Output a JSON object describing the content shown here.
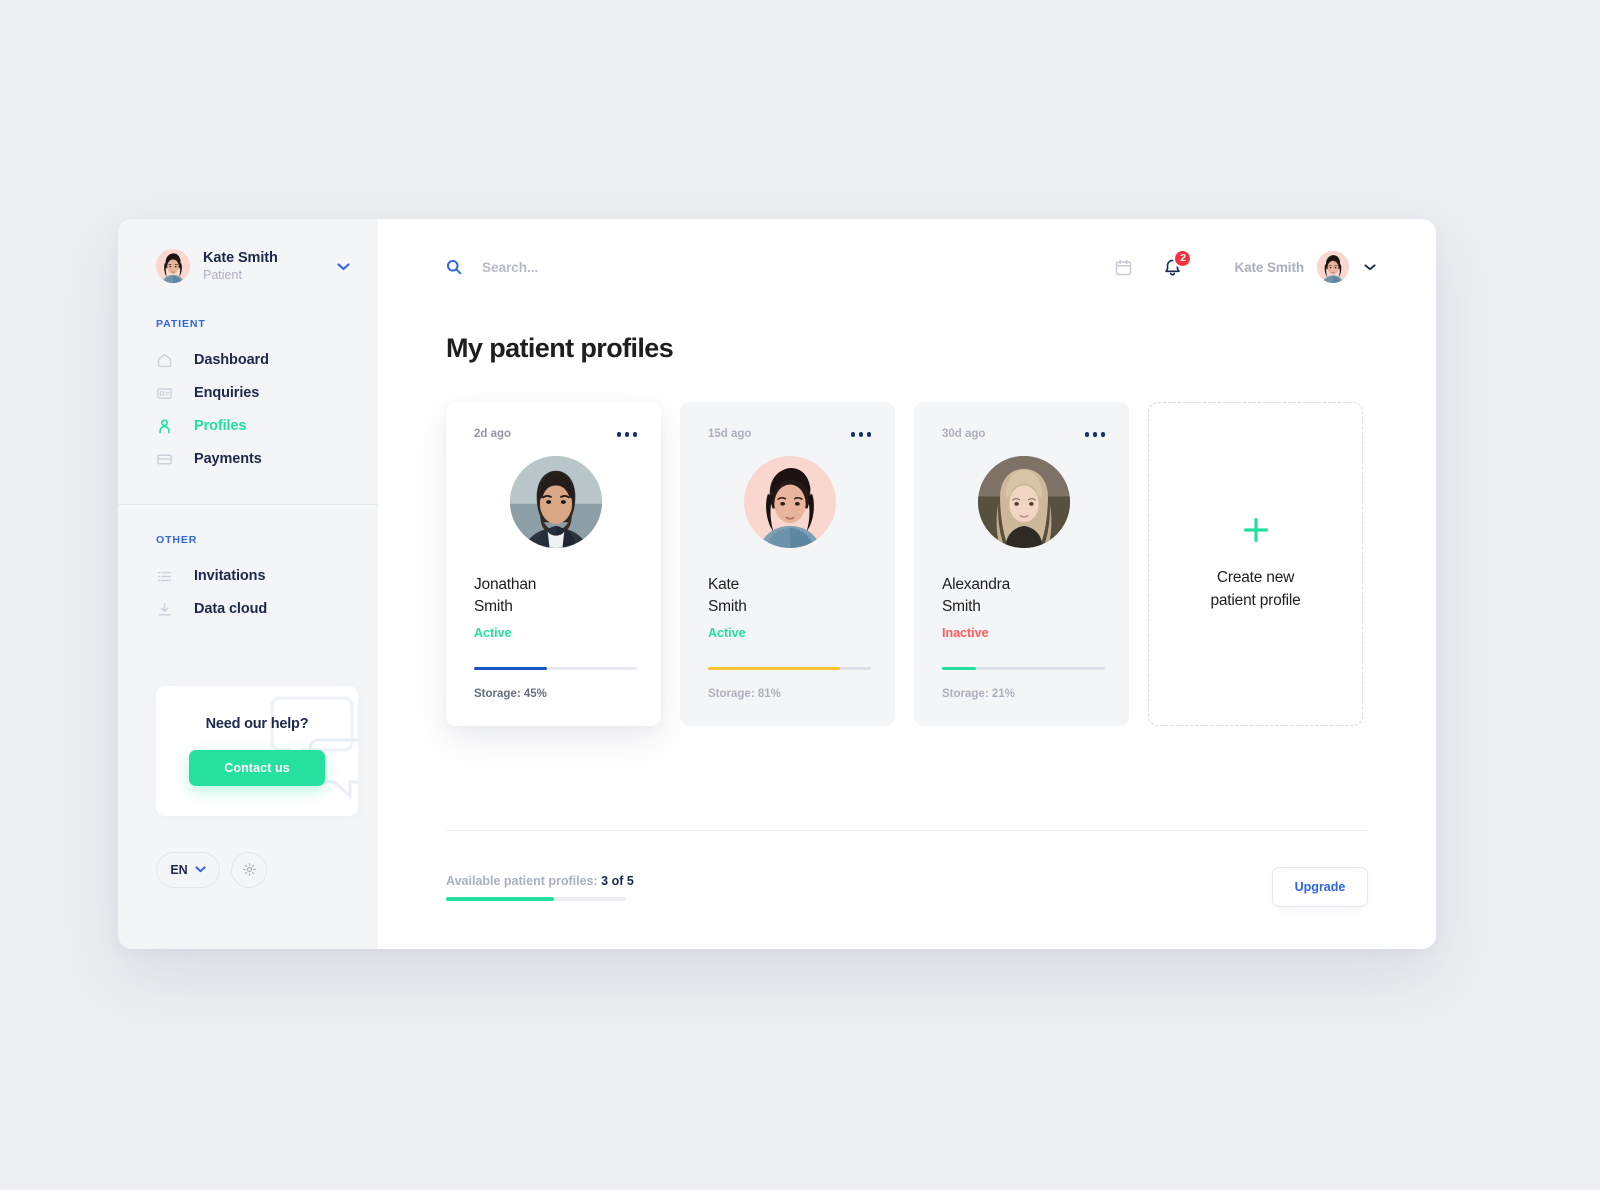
{
  "sidebar": {
    "user": {
      "name": "Kate Smith",
      "role": "Patient",
      "chevron": "chevron-down-icon"
    },
    "section_patient_label": "PATIENT",
    "patient_items": [
      {
        "label": "Dashboard",
        "icon": "home-icon",
        "active": false
      },
      {
        "label": "Enquiries",
        "icon": "id-card-icon",
        "active": false
      },
      {
        "label": "Profiles",
        "icon": "person-icon",
        "active": true
      },
      {
        "label": "Payments",
        "icon": "credit-card-icon",
        "active": false
      }
    ],
    "section_other_label": "OTHER",
    "other_items": [
      {
        "label": "Invitations",
        "icon": "list-icon",
        "active": false
      },
      {
        "label": "Data cloud",
        "icon": "download-icon",
        "active": false
      }
    ],
    "help": {
      "title": "Need our help?",
      "button_label": "Contact us"
    },
    "language": {
      "value": "EN",
      "chevron": "chevron-down-icon"
    },
    "settings_icon": "gear-icon"
  },
  "topbar": {
    "search": {
      "value": "",
      "placeholder": "Search..."
    },
    "calendar_icon": "calendar-icon",
    "bell_icon": "bell-icon",
    "notification_count": "2",
    "user_name": "Kate Smith",
    "user_chevron": "chevron-down-icon"
  },
  "main": {
    "page_title": "My patient profiles",
    "cards": [
      {
        "age": "2d ago",
        "name_line1": "Jonathan",
        "name_line2": "Smith",
        "status": "Active",
        "status_color": "#24e0a0",
        "storage_label": "Storage: 45%",
        "storage_percent": 45,
        "bar_color": "#1a56c4",
        "photo": "photo-jonathan",
        "menu_icon": "more-horizontal-icon",
        "elevated": true
      },
      {
        "age": "15d ago",
        "name_line1": "Kate",
        "name_line2": "Smith",
        "status": "Active",
        "status_color": "#24e0a0",
        "storage_label": "Storage: 81%",
        "storage_percent": 81,
        "bar_color": "#f7c12f",
        "photo": "photo-kate",
        "menu_icon": "more-horizontal-icon",
        "elevated": false
      },
      {
        "age": "30d ago",
        "name_line1": "Alexandra",
        "name_line2": "Smith",
        "status": "Inactive",
        "status_color": "#ff5c5c",
        "storage_label": "Storage: 21%",
        "storage_percent": 21,
        "bar_color": "#24e0a0",
        "photo": "photo-alexandra",
        "menu_icon": "more-horizontal-icon",
        "elevated": false
      }
    ],
    "create_card": {
      "plus_icon": "plus-icon",
      "text_line1": "Create new",
      "text_line2": "patient profile"
    },
    "footer": {
      "available_label": "Available patient profiles:",
      "available_value": "3 of 5",
      "progress_percent": 60,
      "upgrade_label": "Upgrade"
    }
  },
  "colors": {
    "accent_green": "#24e0a0",
    "accent_blue": "#2f66e0",
    "danger_red": "#f5333f",
    "inactive_red": "#ff5c5c",
    "warning_yellow": "#f7c12f",
    "bar_blue": "#1a56c4",
    "text_dark": "#1b2a4b",
    "text_muted": "#a8b0c0",
    "sidebar_bg": "#f4f5f7",
    "page_bg": "#eceef1"
  }
}
